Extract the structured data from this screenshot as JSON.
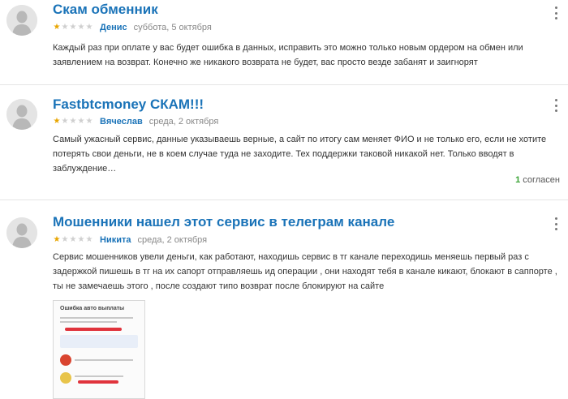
{
  "reviews": [
    {
      "title": "Скам обменник",
      "rating": 1,
      "author": "Денис",
      "date": "суббота, 5 октября",
      "text": "Каждый раз при оплате у вас будет ошибка в данных, исправить это можно только новым ордером на обмен или заявлением на возврат. Конечно же никакого возврата не будет, вас просто везде забанят и заигнорят"
    },
    {
      "title": "Fastbtcmoney СКАМ!!!",
      "rating": 1,
      "author": "Вячеслав",
      "date": "среда, 2 октября",
      "text": "Самый ужасный сервис, данные указываешь верные, а сайт по итогу сам меняет ФИО и не только его, если не хотите потерять свои деньги, не в коем случае туда не заходите. Тех поддержки таковой никакой нет. Только вводят в заблуждение…",
      "agree_count": "1",
      "agree_label": "согласен"
    },
    {
      "title": "Мошенники нашел этот сервис в телеграм канале",
      "rating": 1,
      "author": "Никита",
      "date": "среда, 2 октября",
      "text": "Сервис мошенников увели деньги, как работают, находишь сервис в тг канале переходишь меняешь первый раз с задержкой пишешь в тг на их сапорт отправляешь ид операции , они находят тебя в канале кикают, блокают в саппорте , ты не замечаешь этого , после создают типо возврат после блокируют на сайте",
      "attachment_title": "Ошибка авто выплаты"
    }
  ],
  "colors": {
    "link": "#1a73b8",
    "star": "#e8a500",
    "agree": "#3aa335"
  },
  "icons": {
    "avatar": "user-silhouette-icon",
    "menu": "kebab-menu-icon",
    "star": "star-icon"
  }
}
